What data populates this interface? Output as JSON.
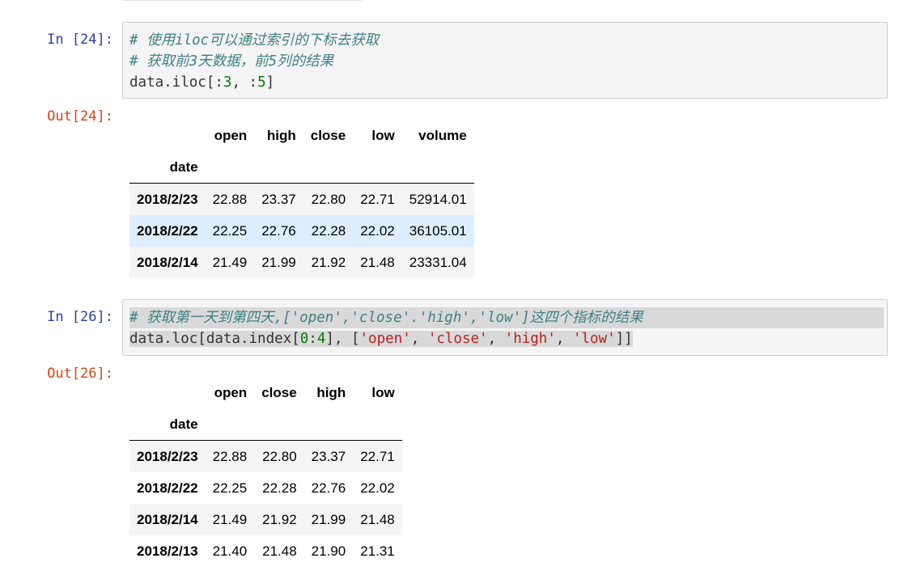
{
  "cell1": {
    "in_prompt": "In  [24]:",
    "out_prompt": "Out[24]:",
    "code": {
      "comment1": "# 使用iloc可以通过索引的下标去获取",
      "comment2": "# 获取前3天数据，前5列的结果",
      "l3_a": "data.iloc[:",
      "l3_n1": "3",
      "l3_b": ", :",
      "l3_n2": "5",
      "l3_c": "]"
    },
    "table": {
      "index_name": "date",
      "columns": [
        "open",
        "high",
        "close",
        "low",
        "volume"
      ],
      "rows": [
        {
          "index": "2018/2/23",
          "values": [
            "22.88",
            "23.37",
            "22.80",
            "22.71",
            "52914.01"
          ]
        },
        {
          "index": "2018/2/22",
          "values": [
            "22.25",
            "22.76",
            "22.28",
            "22.02",
            "36105.01"
          ]
        },
        {
          "index": "2018/2/14",
          "values": [
            "21.49",
            "21.99",
            "21.92",
            "21.48",
            "23331.04"
          ]
        }
      ]
    }
  },
  "cell2": {
    "in_prompt": "In  [26]:",
    "out_prompt": "Out[26]:",
    "code": {
      "comment1": "# 获取第一天到第四天,['open','close'.'high','low']这四个指标的结果",
      "l2_a": "data.loc[data.index[",
      "l2_n1": "0",
      "l2_b": ":",
      "l2_n2": "4",
      "l2_c": "], [",
      "l2_s1": "'open'",
      "l2_d": ", ",
      "l2_s2": "'close'",
      "l2_e": ", ",
      "l2_s3": "'high'",
      "l2_f": ", ",
      "l2_s4": "'low'",
      "l2_g": "]]"
    },
    "table": {
      "index_name": "date",
      "columns": [
        "open",
        "close",
        "high",
        "low"
      ],
      "rows": [
        {
          "index": "2018/2/23",
          "values": [
            "22.88",
            "22.80",
            "23.37",
            "22.71"
          ]
        },
        {
          "index": "2018/2/22",
          "values": [
            "22.25",
            "22.28",
            "22.76",
            "22.02"
          ]
        },
        {
          "index": "2018/2/14",
          "values": [
            "21.49",
            "21.92",
            "21.99",
            "21.48"
          ]
        },
        {
          "index": "2018/2/13",
          "values": [
            "21.40",
            "21.48",
            "21.90",
            "21.31"
          ]
        }
      ]
    }
  }
}
